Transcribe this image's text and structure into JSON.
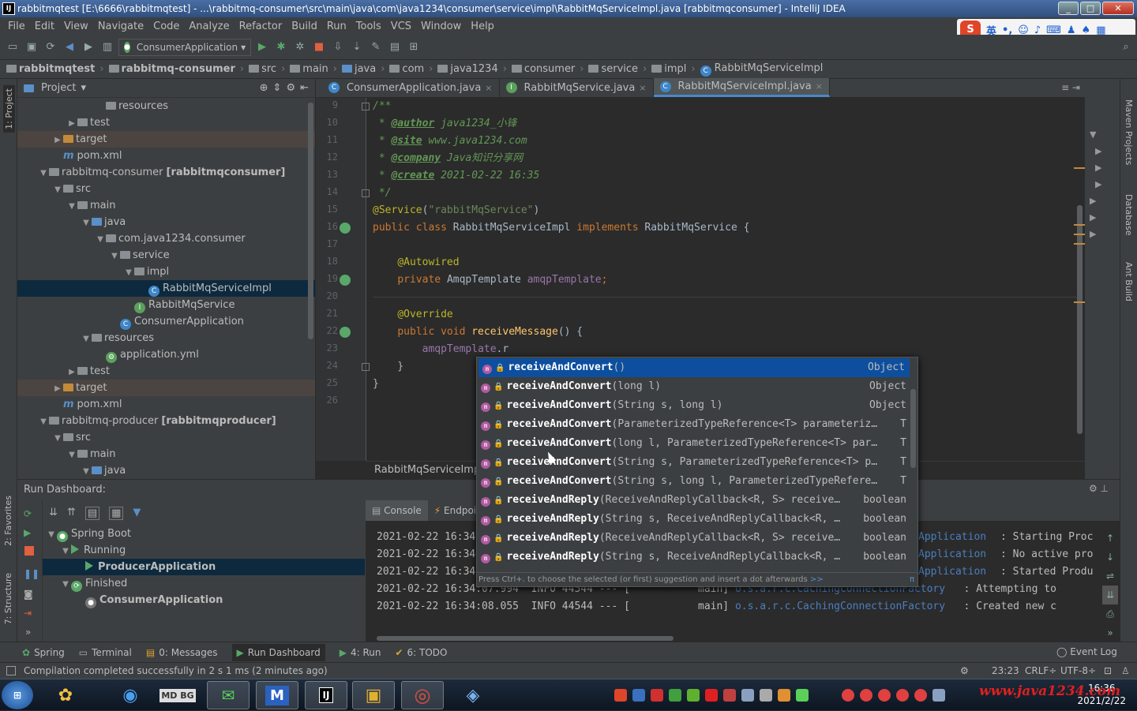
{
  "title_bar": {
    "text": "rabbitmqtest [E:\\6666\\rabbitmqtest] - ...\\rabbitmq-consumer\\src\\main\\java\\com\\java1234\\consumer\\service\\impl\\RabbitMqServiceImpl.java [rabbitmqconsumer] - IntelliJ IDEA",
    "app_icon": "IJ"
  },
  "menu": [
    "File",
    "Edit",
    "View",
    "Navigate",
    "Code",
    "Analyze",
    "Refactor",
    "Build",
    "Run",
    "Tools",
    "VCS",
    "Window",
    "Help"
  ],
  "ime": {
    "label": "英"
  },
  "toolbar": {
    "run_config": "ConsumerApplication"
  },
  "breadcrumbs": [
    "rabbitmqtest",
    "rabbitmq-consumer",
    "src",
    "main",
    "java",
    "com",
    "java1234",
    "consumer",
    "service",
    "impl",
    "RabbitMqServiceImpl"
  ],
  "left_strip": {
    "project": "1: Project",
    "favorites": "2: Favorites",
    "structure": "7: Structure"
  },
  "right_strip": {
    "maven": "Maven Projects",
    "database": "Database",
    "ant": "Ant Build"
  },
  "project_panel": {
    "header": "Project",
    "rows": [
      {
        "label": "resources",
        "indent": 5,
        "arrow": "",
        "icon": "folder"
      },
      {
        "label": "test",
        "indent": 3,
        "arrow": "▶",
        "icon": "folder"
      },
      {
        "label": "target",
        "indent": 2,
        "arrow": "▶",
        "icon": "folder-orange"
      },
      {
        "label": "pom.xml",
        "indent": 2,
        "arrow": "",
        "icon": "maven"
      },
      {
        "label": "rabbitmq-consumer",
        "suffix": "[rabbitmqconsumer]",
        "indent": 1,
        "arrow": "▼",
        "icon": "folder"
      },
      {
        "label": "src",
        "indent": 2,
        "arrow": "▼",
        "icon": "folder"
      },
      {
        "label": "main",
        "indent": 3,
        "arrow": "▼",
        "icon": "folder"
      },
      {
        "label": "java",
        "indent": 4,
        "arrow": "▼",
        "icon": "folder-blue"
      },
      {
        "label": "com.java1234.consumer",
        "indent": 5,
        "arrow": "▼",
        "icon": "folder"
      },
      {
        "label": "service",
        "indent": 6,
        "arrow": "▼",
        "icon": "folder"
      },
      {
        "label": "impl",
        "indent": 7,
        "arrow": "▼",
        "icon": "folder"
      },
      {
        "label": "RabbitMqServiceImpl",
        "indent": 8,
        "arrow": "",
        "icon": "class"
      },
      {
        "label": "RabbitMqService",
        "indent": 7,
        "arrow": "",
        "icon": "interface"
      },
      {
        "label": "ConsumerApplication",
        "indent": 6,
        "arrow": "",
        "icon": "class"
      },
      {
        "label": "resources",
        "indent": 4,
        "arrow": "▼",
        "icon": "folder"
      },
      {
        "label": "application.yml",
        "indent": 5,
        "arrow": "",
        "icon": "yml"
      },
      {
        "label": "test",
        "indent": 3,
        "arrow": "▶",
        "icon": "folder"
      },
      {
        "label": "target",
        "indent": 2,
        "arrow": "▶",
        "icon": "folder-orange"
      },
      {
        "label": "pom.xml",
        "indent": 2,
        "arrow": "",
        "icon": "maven"
      },
      {
        "label": "rabbitmq-producer",
        "suffix": "[rabbitmqproducer]",
        "indent": 1,
        "arrow": "▼",
        "icon": "folder"
      },
      {
        "label": "src",
        "indent": 2,
        "arrow": "▼",
        "icon": "folder"
      },
      {
        "label": "main",
        "indent": 3,
        "arrow": "▼",
        "icon": "folder"
      },
      {
        "label": "java",
        "indent": 4,
        "arrow": "▼",
        "icon": "folder-blue"
      }
    ]
  },
  "editor": {
    "tabs": [
      {
        "label": "ConsumerApplication.java",
        "active": false
      },
      {
        "label": "RabbitMqService.java",
        "active": false
      },
      {
        "label": "RabbitMqServiceImpl.java",
        "active": true
      }
    ],
    "line_numbers": [
      "9",
      "10",
      "11",
      "12",
      "13",
      "14",
      "15",
      "16",
      "17",
      "18",
      "19",
      "20",
      "21",
      "22",
      "23",
      "24",
      "25",
      "26"
    ],
    "code_lines": [
      [
        {
          "t": "/**",
          "c": "cmt"
        }
      ],
      [
        {
          "t": " * ",
          "c": "cmt"
        },
        {
          "t": "@author",
          "c": "tag"
        },
        {
          "t": " java1234_小锋",
          "c": "cmt"
        }
      ],
      [
        {
          "t": " * ",
          "c": "cmt"
        },
        {
          "t": "@site",
          "c": "tag"
        },
        {
          "t": " www.java1234.com",
          "c": "cmt"
        }
      ],
      [
        {
          "t": " * ",
          "c": "cmt"
        },
        {
          "t": "@company",
          "c": "tag"
        },
        {
          "t": " Java知识分享网",
          "c": "cmt"
        }
      ],
      [
        {
          "t": " * ",
          "c": "cmt"
        },
        {
          "t": "@create",
          "c": "tag"
        },
        {
          "t": " 2021-02-22 16:35",
          "c": "cmt"
        }
      ],
      [
        {
          "t": " */",
          "c": "cmt"
        }
      ],
      [
        {
          "t": "@Service",
          "c": "ann"
        },
        {
          "t": "(",
          "c": ""
        },
        {
          "t": "\"rabbitMqService\"",
          "c": "str"
        },
        {
          "t": ")",
          "c": ""
        }
      ],
      [
        {
          "t": "public class ",
          "c": "kw"
        },
        {
          "t": "RabbitMqServiceImpl ",
          "c": ""
        },
        {
          "t": "implements ",
          "c": "kw"
        },
        {
          "t": "RabbitMqService {",
          "c": ""
        }
      ],
      [],
      [
        {
          "t": "    ",
          "c": ""
        },
        {
          "t": "@Autowired",
          "c": "ann"
        }
      ],
      [
        {
          "t": "    ",
          "c": ""
        },
        {
          "t": "private ",
          "c": "kw"
        },
        {
          "t": "AmqpTemplate ",
          "c": ""
        },
        {
          "t": "amqpTemplate",
          "c": "fld"
        },
        {
          "t": ";",
          "c": "kw"
        }
      ],
      [],
      [
        {
          "t": "    ",
          "c": ""
        },
        {
          "t": "@Override",
          "c": "ann"
        }
      ],
      [
        {
          "t": "    ",
          "c": ""
        },
        {
          "t": "public void ",
          "c": "kw"
        },
        {
          "t": "receiveMessage",
          "c": "fn"
        },
        {
          "t": "() {",
          "c": ""
        }
      ],
      [
        {
          "t": "        ",
          "c": ""
        },
        {
          "t": "amqpTemplate",
          "c": "fld"
        },
        {
          "t": ".r",
          "c": ""
        }
      ],
      [
        {
          "t": "    }",
          "c": ""
        }
      ],
      [
        {
          "t": "}",
          "c": ""
        }
      ],
      []
    ],
    "breadcrumb": "RabbitMqServiceImpl"
  },
  "completion": {
    "items": [
      {
        "name": "receiveAndConvert",
        "args": "()",
        "ret": "Object"
      },
      {
        "name": "receiveAndConvert",
        "args": "(long l)",
        "ret": "Object"
      },
      {
        "name": "receiveAndConvert",
        "args": "(String s, long l)",
        "ret": "Object"
      },
      {
        "name": "receiveAndConvert",
        "args": "(ParameterizedTypeReference<T> parameteriz…",
        "ret": "T"
      },
      {
        "name": "receiveAndConvert",
        "args": "(long l, ParameterizedTypeReference<T> par…",
        "ret": "T"
      },
      {
        "name": "receiveAndConvert",
        "args": "(String s, ParameterizedTypeReference<T> p…",
        "ret": "T"
      },
      {
        "name": "receiveAndConvert",
        "args": "(String s, long l, ParameterizedTypeRefere…",
        "ret": "T"
      },
      {
        "name": "receiveAndReply",
        "args": "(ReceiveAndReplyCallback<R, S> receive…",
        "ret": "boolean"
      },
      {
        "name": "receiveAndReply",
        "args": "(String s, ReceiveAndReplyCallback<R, …",
        "ret": "boolean"
      },
      {
        "name": "receiveAndReply",
        "args": "(ReceiveAndReplyCallback<R, S> receive…",
        "ret": "boolean"
      },
      {
        "name": "receiveAndReply",
        "args": "(String s, ReceiveAndReplyCallback<R, …",
        "ret": "boolean"
      }
    ],
    "footer": "Press Ctrl+. to choose the selected (or first) suggestion and insert a dot afterwards",
    "footer_link": ">>",
    "pi": "π"
  },
  "run_dashboard": {
    "header": "Run Dashboard:",
    "tree": [
      {
        "label": "Spring Boot",
        "indent": 0,
        "arrow": "▼",
        "bold": false
      },
      {
        "label": "Running",
        "indent": 1,
        "arrow": "▼",
        "bold": false
      },
      {
        "label": "ProducerApplication",
        "indent": 2,
        "arrow": "",
        "bold": true
      },
      {
        "label": "Finished",
        "indent": 1,
        "arrow": "▼",
        "bold": false
      },
      {
        "label": "ConsumerApplication",
        "indent": 2,
        "arrow": "",
        "bold": true
      }
    ],
    "console_tabs": [
      "Console",
      "Endpoin"
    ],
    "console_lines": [
      {
        "left": "2021-02-22 16:34",
        "right": "Application",
        "msg": ": Starting Proc"
      },
      {
        "left": "2021-02-22 16:34",
        "right": "Application",
        "msg": ": No active pro"
      },
      {
        "left": "2021-02-22 16:34",
        "right": "Application",
        "msg": ": Started Produ"
      },
      {
        "left": "2021-02-22 16:34:07.994  INFO 44544 --- [           main] ",
        "right": "o.s.a.r.c.CachingConnectionFactory",
        "msg": "   : Attempting to"
      },
      {
        "left": "2021-02-22 16:34:08.055  INFO 44544 --- [           main] ",
        "right": "o.s.a.r.c.CachingConnectionFactory",
        "msg": "   : Created new c"
      }
    ]
  },
  "bottom_tabs": [
    {
      "label": "Spring",
      "active": false
    },
    {
      "label": "Terminal",
      "active": false
    },
    {
      "label": "0: Messages",
      "active": false
    },
    {
      "label": "Run Dashboard",
      "active": true
    },
    {
      "label": "4: Run",
      "active": false
    },
    {
      "label": "6: TODO",
      "active": false
    }
  ],
  "event_log": "Event Log",
  "status": {
    "message": "Compilation completed successfully in 2 s 1 ms (2 minutes ago)",
    "position": "23:23",
    "line_sep": "CRLF÷",
    "encoding": "UTF-8÷"
  },
  "taskbar": {
    "tasks": [
      "⊞",
      "✿",
      "◉",
      "MD BG",
      "✉",
      "M",
      "IJ",
      "▣",
      "◎",
      "◈"
    ],
    "time": "16:36",
    "date": "2021/2/22",
    "watermark": "www.java1234.com"
  }
}
